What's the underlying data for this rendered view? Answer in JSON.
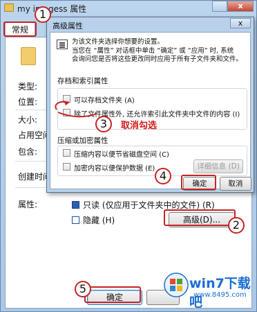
{
  "outer_window": {
    "title": "my imagess 属性",
    "close_glyph": "x",
    "tab": "常规",
    "labels": {
      "type": "类型:",
      "location": "位置:",
      "size": "大小:",
      "size_on_disk": "占用空间",
      "contains": "包含:",
      "created": "创建时间",
      "attributes": "属性:"
    },
    "attributes": {
      "readonly": "只读 (仅应用于文件夹中的文件) (R)",
      "hidden": "隐藏 (H)",
      "advanced_button": "高级(D)..."
    },
    "ok_button": "确定"
  },
  "dialog": {
    "title": "高级属性",
    "close_glyph": "x",
    "info_line1": "为该文件夹选择你想要的设置。",
    "info_line2": "当您在 “属性” 对话框中单击 “确定” 或 “应用” 时, 系统",
    "info_line3": "会询问您是否将这些更改同时应用于所有子文件夹和文件。",
    "archive_group": "存档和索引属性",
    "archive_checkbox": "可以存档文件夹 (A)",
    "index_checkbox": "除了文件属性外, 还允许索引此文件夹中文件的内容 (I)",
    "compress_group": "压缩或加密属性",
    "compress_checkbox": "压缩内容以便节省磁盘空间 (C)",
    "encrypt_checkbox": "加密内容以便保护数据 (E)",
    "details_button": "详细信息 (D)",
    "ok_button": "确定",
    "cancel_button": "取消"
  },
  "annotations": {
    "step1": "1",
    "step2": "2",
    "step3": "3",
    "step4": "4",
    "step5": "5",
    "step3_text": "取消勾选",
    "color": "#c62323"
  },
  "watermark": {
    "title": "win7下载吧",
    "url": "www.8495.com",
    "color": "#1a6ed1"
  }
}
